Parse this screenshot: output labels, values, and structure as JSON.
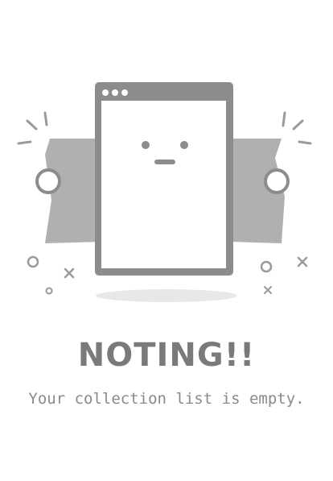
{
  "empty_state": {
    "title": "NOTING!!",
    "message": "Your collection list is empty."
  },
  "colors": {
    "illustration_gray": "#8c8c8c",
    "banner_gray": "#b0b0b0",
    "shadow_gray": "#e8e8e8",
    "text_gray": "#7a7a7a"
  },
  "icons": {
    "illustration": "empty-browser-window-with-face-icon"
  }
}
